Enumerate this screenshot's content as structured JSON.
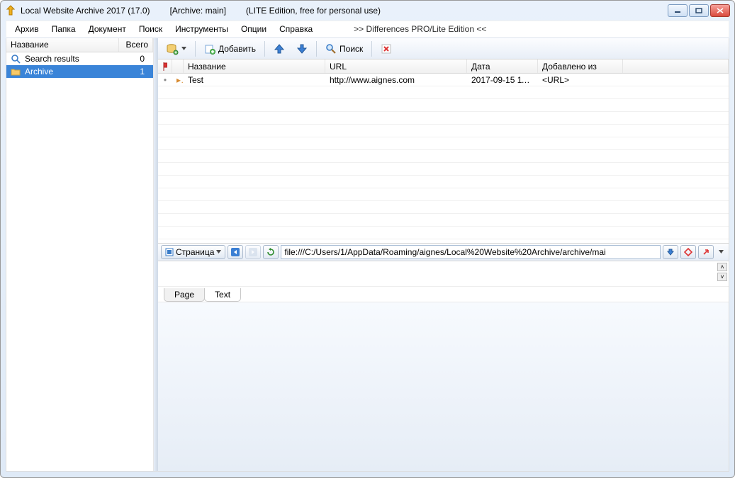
{
  "title": {
    "app": "Local Website Archive 2017 (17.0)",
    "archive": "[Archive: main]",
    "edition": "(LITE Edition, free for personal use)"
  },
  "menu": {
    "items": [
      "Архив",
      "Папка",
      "Документ",
      "Поиск",
      "Инструменты",
      "Опции",
      "Справка"
    ],
    "promo": ">> Differences PRO/Lite Edition <<"
  },
  "sidebar": {
    "cols": {
      "name": "Название",
      "count": "Всего"
    },
    "items": [
      {
        "icon": "magnify",
        "label": "Search results",
        "count": "0",
        "selected": false
      },
      {
        "icon": "folder",
        "label": "Archive",
        "count": "1",
        "selected": true
      }
    ]
  },
  "toolbar": {
    "add_label": "Добавить",
    "search_label": "Поиск"
  },
  "grid": {
    "cols": {
      "name": "Название",
      "url": "URL",
      "date": "Дата",
      "added": "Добавлено из"
    },
    "rows": [
      {
        "name": "Test",
        "url": "http://www.aignes.com",
        "date": "2017-09-15 11:...",
        "added": "<URL>"
      }
    ]
  },
  "bottom": {
    "page_label": "Страница",
    "url": "file:///C:/Users/1/AppData/Roaming/aignes/Local%20Website%20Archive/archive/mai"
  },
  "tabs": {
    "page": "Page",
    "text": "Text"
  }
}
